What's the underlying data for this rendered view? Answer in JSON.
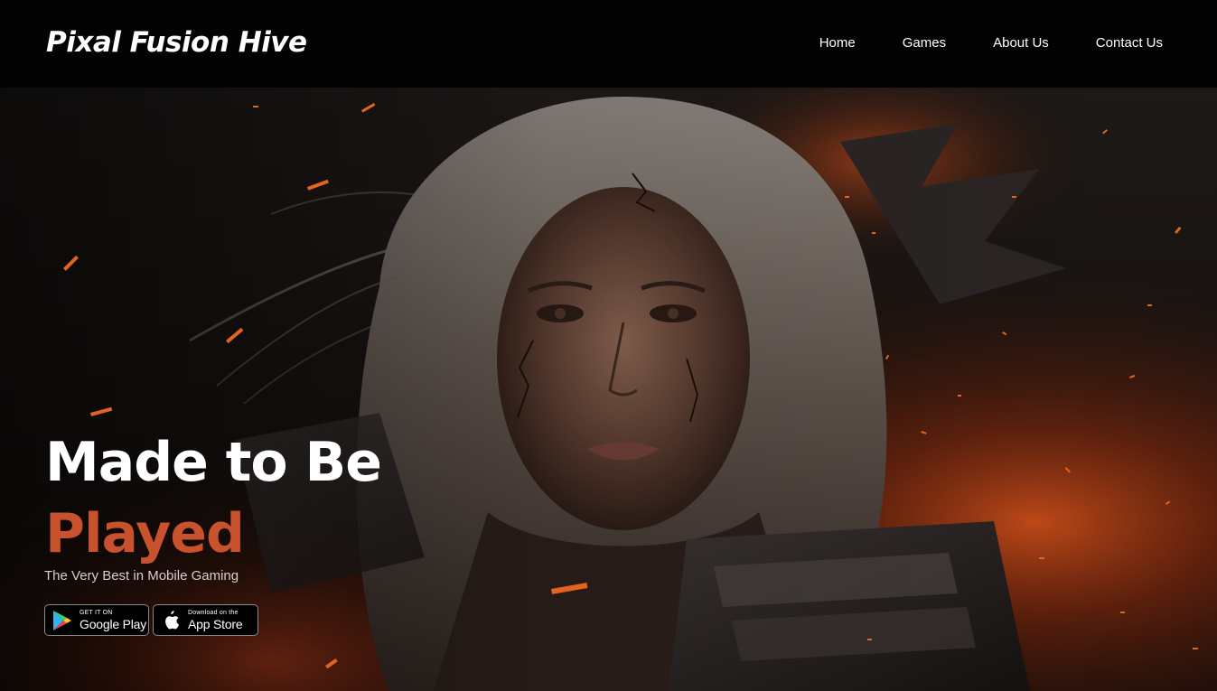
{
  "header": {
    "logo": "Pixal Fusion Hive",
    "nav": [
      {
        "label": "Home"
      },
      {
        "label": "Games"
      },
      {
        "label": "About Us"
      },
      {
        "label": "Contact Us"
      }
    ]
  },
  "hero": {
    "title_line1": "Made to Be",
    "title_line2": "Played",
    "subtitle": "The Very Best in Mobile Gaming",
    "accent_color": "#c8512e",
    "background_image": "dark-fantasy-warrior-woman-with-fire-embers",
    "stores": {
      "google": {
        "small": "GET IT ON",
        "big": "Google Play",
        "icon": "google-play-icon"
      },
      "apple": {
        "small": "Download on the",
        "big": "App Store",
        "icon": "apple-icon"
      }
    }
  }
}
